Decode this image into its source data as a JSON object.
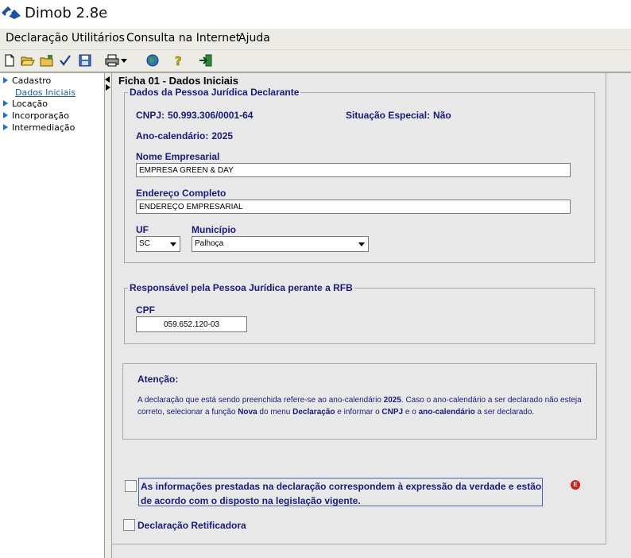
{
  "window": {
    "title": "Dimob 2.8e"
  },
  "menu": [
    {
      "label": "Declaração"
    },
    {
      "label": "Utilitários"
    },
    {
      "label": "Consulta na Internet"
    },
    {
      "label": "Ajuda"
    }
  ],
  "toolbar": {
    "icons": [
      "new-file-icon",
      "open-folder-icon",
      "import-folder-icon",
      "check-icon",
      "save-icon",
      "print-icon",
      "dropdown-arrow-icon",
      "globe-icon",
      "help-icon",
      "exit-icon"
    ]
  },
  "tree": {
    "items": [
      {
        "label": "Cadastro",
        "sub": "Dados Iniciais"
      },
      {
        "label": "Locação"
      },
      {
        "label": "Incorporação"
      },
      {
        "label": "Intermediação"
      }
    ]
  },
  "form": {
    "title": "Ficha 01 - Dados Iniciais",
    "declarante": {
      "legend": "Dados da Pessoa Jurídica Declarante",
      "cnpj_label": "CNPJ:",
      "cnpj_value": "50.993.306/0001-64",
      "situacao_label": "Situação Especial:",
      "situacao_value": "Não",
      "ano_label": "Ano-calendário:",
      "ano_value": "2025",
      "nome_label": "Nome Empresarial",
      "nome_value": "EMPRESA GREEN & DAY",
      "endereco_label": "Endereço Completo",
      "endereco_value": "ENDEREÇO EMPRESARIAL",
      "uf_label": "UF",
      "uf_value": "SC",
      "municipio_label": "Município",
      "municipio_value": "Palhoça"
    },
    "responsavel": {
      "legend": "Responsável pela Pessoa Jurídica perante a RFB",
      "cpf_label": "CPF",
      "cpf_value": "059.652.120-03"
    },
    "atencao": {
      "title": "Atenção:",
      "line1_a": "A declaração que está sendo preenchida refere-se ao ano-calendário ",
      "line1_year": "2025",
      "line1_b": ". Caso o ano-calendário a ser declarado não esteja correto, selecionar a função ",
      "nova": "Nova",
      "line1_c": " do menu ",
      "menu_decl": "Declaração",
      "line1_d": " e informar o ",
      "cnpj": "CNPJ",
      "line1_e": " e o ",
      "anocal": "ano-calendário",
      "line1_f": " a ser declarado."
    },
    "declaracao_text": "As informações prestadas na declaração correspondem à expressão da verdade e estão de acordo com o disposto na legislação vigente.",
    "error_badge": "E",
    "retificadora_label": "Declaração Retificadora"
  },
  "colors": {
    "label": "#1a1a80",
    "error": "#d21b1b",
    "tree_arrow": "#1f6fd1"
  }
}
